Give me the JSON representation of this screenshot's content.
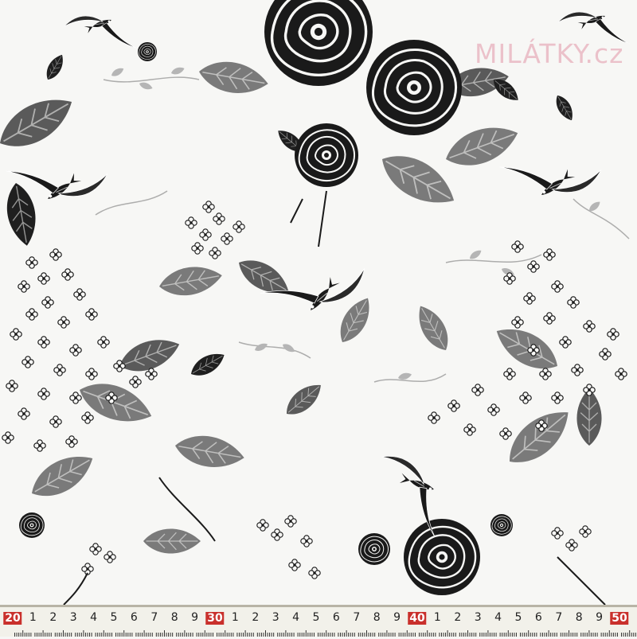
{
  "image": {
    "subject": "black, white and grey floral fabric print",
    "palette": {
      "background": "#f7f7f5",
      "dark": "#1a1a1a",
      "mid_grey": "#7a7a7a",
      "light_grey": "#b5b5b5"
    }
  },
  "watermark": {
    "text": "MILÁTKY.cz"
  },
  "ruler": {
    "labels": [
      "20",
      "1",
      "2",
      "3",
      "4",
      "5",
      "6",
      "7",
      "8",
      "9",
      "30",
      "1",
      "2",
      "3",
      "4",
      "5",
      "6",
      "7",
      "8",
      "9",
      "40",
      "1",
      "2",
      "3",
      "4",
      "5",
      "6",
      "7",
      "8",
      "9",
      "50"
    ],
    "major_labels": [
      "20",
      "30",
      "40",
      "50"
    ],
    "accent_color": "#c9302c"
  }
}
